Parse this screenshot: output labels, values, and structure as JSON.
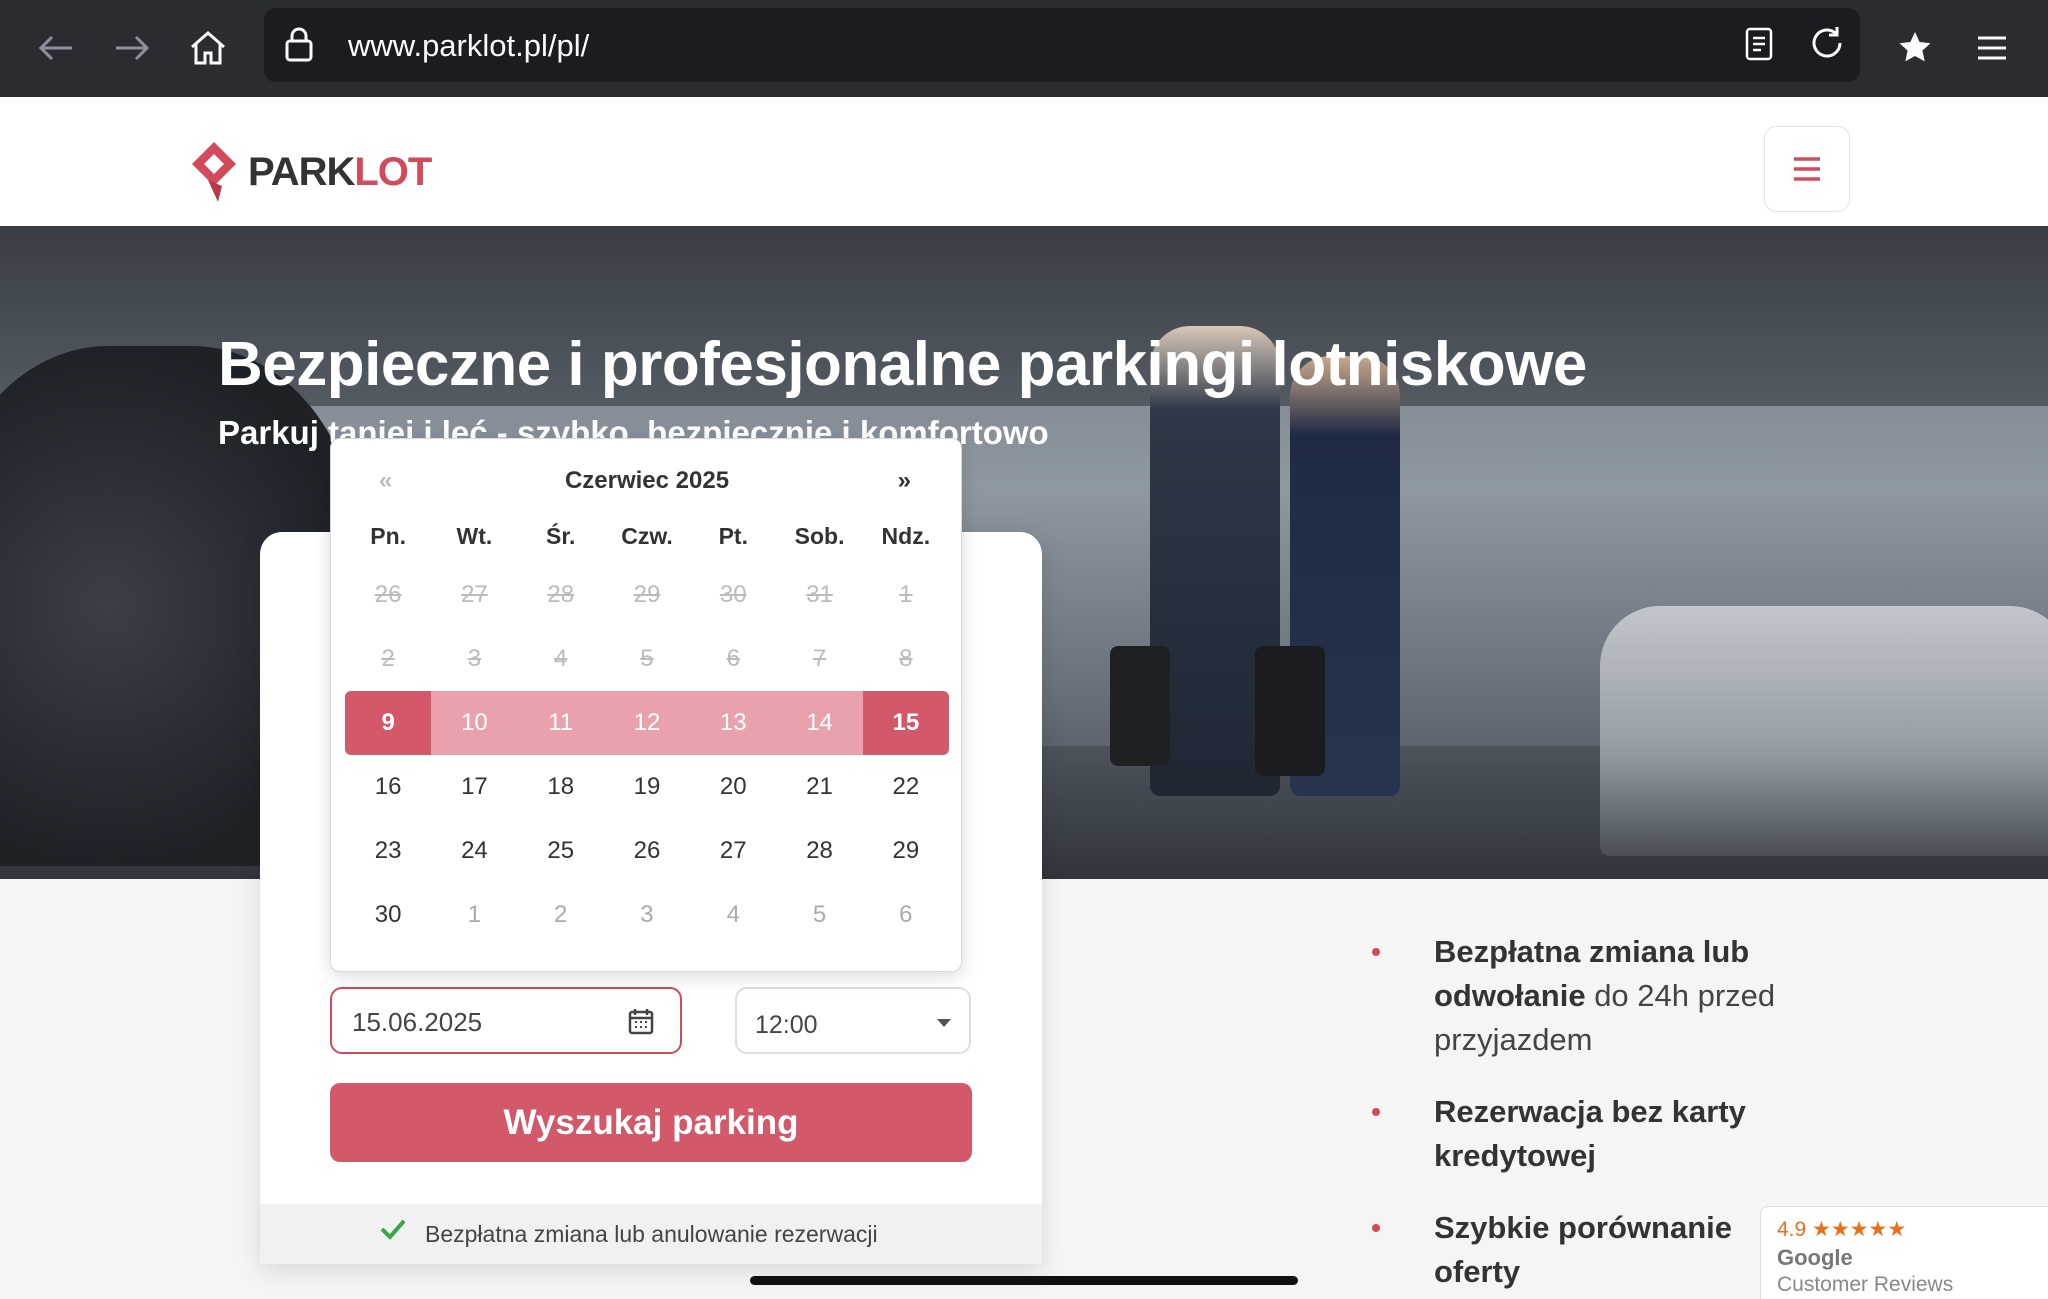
{
  "browser": {
    "url": "www.parklot.pl/pl/",
    "icons": [
      "back-icon",
      "forward-icon",
      "home-icon",
      "lock-icon",
      "reader-icon",
      "reload-icon",
      "bookmarks-icon",
      "menu-icon"
    ]
  },
  "header": {
    "logo_text_main": "PARK",
    "logo_text_accent": "LOT",
    "brand_color": "#d24a5c"
  },
  "hero": {
    "title": "Bezpieczne i profesjonalne parkingi lotniskowe",
    "subtitle": "Parkuj taniej i leć - szybko, bezpiecznie i komfortowo"
  },
  "calendar": {
    "month_title": "Czerwiec 2025",
    "prev": "«",
    "next": "»",
    "weekdays": [
      "Pn.",
      "Wt.",
      "Śr.",
      "Czw.",
      "Pt.",
      "Sob.",
      "Ndz."
    ],
    "weeks": [
      [
        "26",
        "27",
        "28",
        "29",
        "30",
        "31",
        "1"
      ],
      [
        "2",
        "3",
        "4",
        "5",
        "6",
        "7",
        "8"
      ],
      [
        "9",
        "10",
        "11",
        "12",
        "13",
        "14",
        "15"
      ],
      [
        "16",
        "17",
        "18",
        "19",
        "20",
        "21",
        "22"
      ],
      [
        "23",
        "24",
        "25",
        "26",
        "27",
        "28",
        "29"
      ],
      [
        "30",
        "1",
        "2",
        "3",
        "4",
        "5",
        "6"
      ]
    ],
    "range_start": "9",
    "range_end": "15"
  },
  "form": {
    "return_date": "15.06.2025",
    "return_time": "12:00",
    "search_button": "Wyszukaj parking",
    "footer_note": "Bezpłatna zmiana lub anulowanie rezerwacji"
  },
  "features": [
    {
      "bold": "Bezpłatna zmiana lub odwołanie",
      "rest": " do 24h przed przyjazdem"
    },
    {
      "bold": "",
      "rest": "Rezerwacja bez karty kredytowej"
    },
    {
      "bold": "",
      "rest": "Szybkie porównanie oferty"
    }
  ],
  "google_badge": {
    "rating": "4.9 ★★★★★",
    "brand": "Google",
    "label": "Customer Reviews"
  }
}
